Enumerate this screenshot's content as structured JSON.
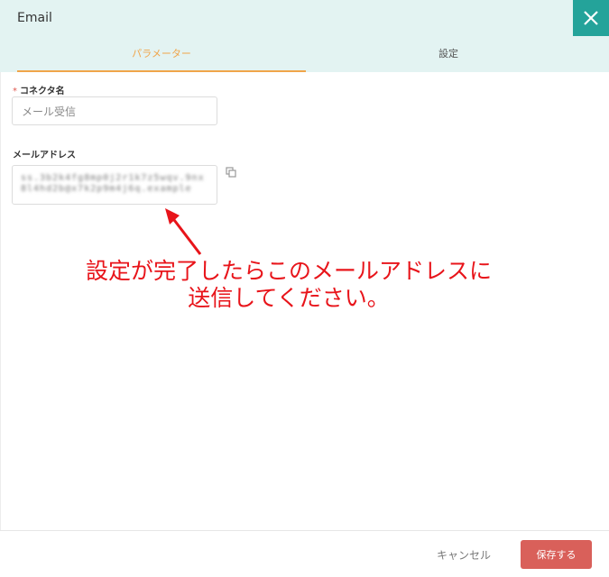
{
  "dialog": {
    "title": "Email",
    "close_icon": "close-icon"
  },
  "tabs": [
    {
      "label": "パラメーター",
      "active": true
    },
    {
      "label": "設定",
      "active": false
    }
  ],
  "form": {
    "connector_name": {
      "label": "コネクタ名",
      "required_mark": "*",
      "value": "メール受信"
    },
    "email_address": {
      "label": "メールアドレス",
      "value_redacted": "ss.3b2k4fg8mp0j2r1k7z5wqv.9nx8l4hd2b@x7k2p9m4j6q.example",
      "copy_icon": "copy-icon"
    }
  },
  "annotation": {
    "line1": "設定が完了したらこのメールアドレスに",
    "line2": "送信してください。",
    "color": "#e8141a"
  },
  "footer": {
    "cancel_label": "キャンセル",
    "save_label": "保存する"
  },
  "colors": {
    "accent_tab": "#f0a54a",
    "close_bg": "#24a39a",
    "save_bg": "#d9605a",
    "header_bg": "#e3f3f2"
  }
}
